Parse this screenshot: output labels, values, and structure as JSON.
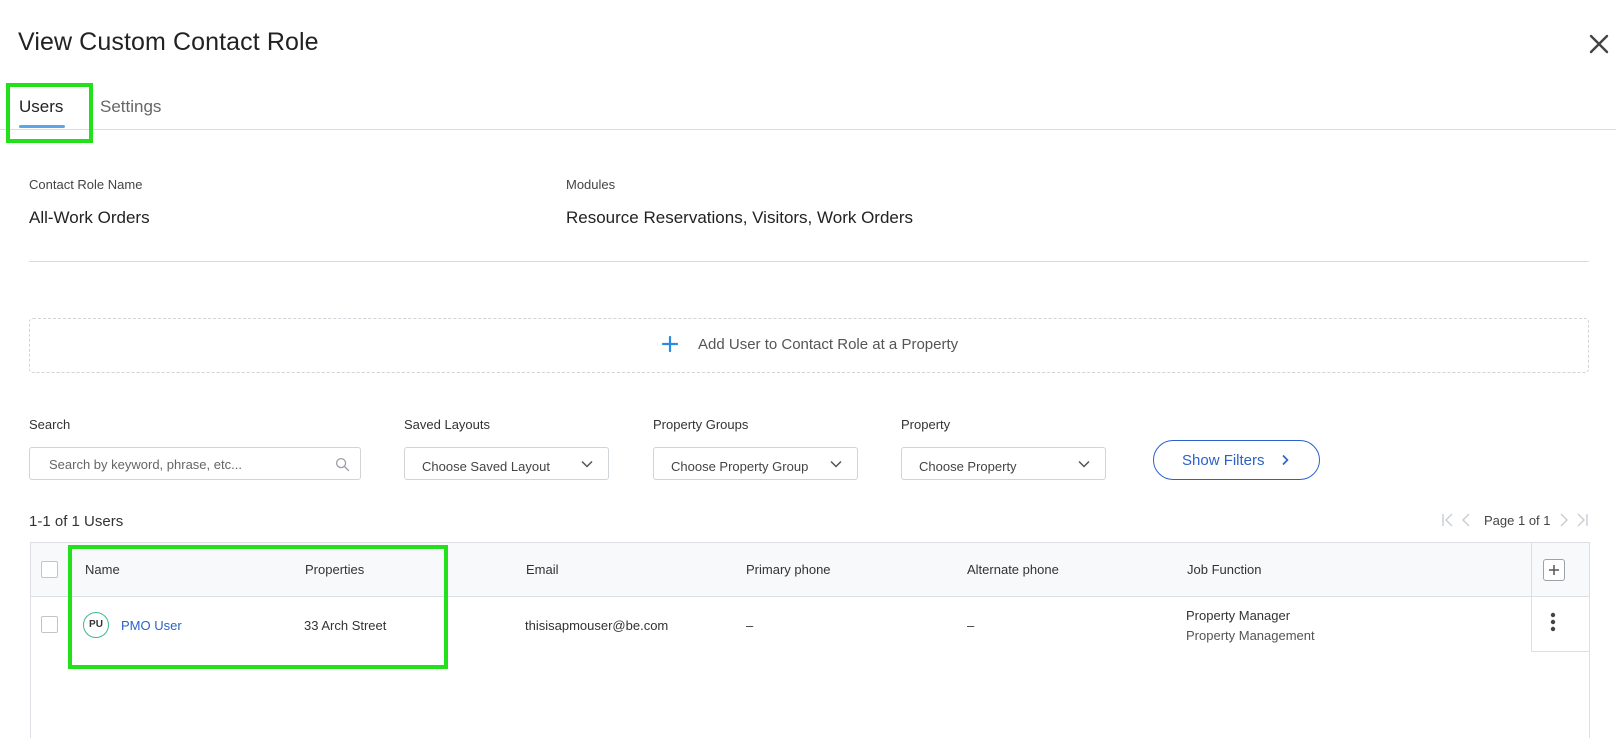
{
  "header": {
    "title": "View Custom Contact Role"
  },
  "tabs": [
    {
      "label": "Users"
    },
    {
      "label": "Settings"
    }
  ],
  "role": {
    "name_label": "Contact Role Name",
    "name_value": "All-Work Orders",
    "modules_label": "Modules",
    "modules_value": "Resource Reservations, Visitors, Work Orders"
  },
  "add_user": {
    "label": "Add User to Contact Role at a Property"
  },
  "filters": {
    "search_label": "Search",
    "search_placeholder": "Search by keyword, phrase, etc...",
    "saved_layouts_label": "Saved Layouts",
    "saved_layouts_value": "Choose Saved Layout",
    "property_groups_label": "Property Groups",
    "property_groups_value": "Choose Property Group",
    "property_label": "Property",
    "property_value": "Choose Property",
    "show_filters_label": "Show Filters"
  },
  "results": {
    "count_text": "1-1 of 1 Users",
    "page_text": "Page 1 of 1"
  },
  "table": {
    "columns": [
      "Name",
      "Properties",
      "Email",
      "Primary phone",
      "Alternate phone",
      "Job Function"
    ],
    "rows": [
      {
        "initials": "PU",
        "name": "PMO User",
        "property": "33 Arch Street",
        "email": "thisisapmouser@be.com",
        "primary_phone": "–",
        "alternate_phone": "–",
        "job_function_1": "Property Manager",
        "job_function_2": "Property Management"
      }
    ]
  },
  "colors": {
    "accent": "#2a62c8",
    "tab_underline": "#5aa7e8",
    "highlight": "#22e01a",
    "avatar_ring": "#3fb98a"
  }
}
